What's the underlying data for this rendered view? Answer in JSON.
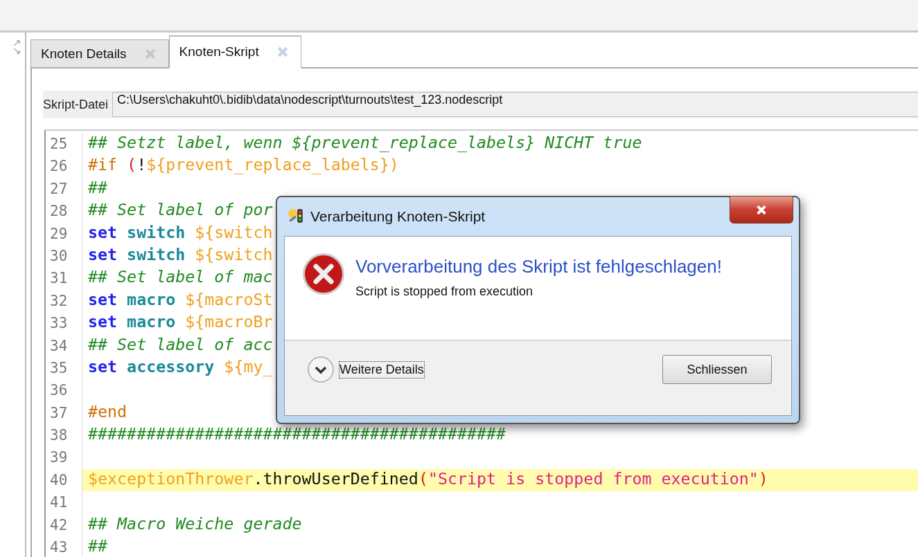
{
  "tabs": [
    {
      "label": "Knoten Details",
      "selected": false
    },
    {
      "label": "Knoten-Skript",
      "selected": true
    }
  ],
  "script_file": {
    "label": "Skript-Datei",
    "value": "C:\\Users\\chakuht0\\.bidib\\data\\nodescript\\turnouts\\test_123.nodescript"
  },
  "editor": {
    "lines": [
      {
        "number": "25",
        "highlighted": false,
        "tokens": [
          {
            "text": "## Setzt label, wenn ${prevent_replace_labels} NICHT true",
            "kind": "comment"
          }
        ]
      },
      {
        "number": "26",
        "highlighted": false,
        "tokens": [
          {
            "text": "#if ",
            "kind": "directive"
          },
          {
            "text": "(",
            "kind": "paren"
          },
          {
            "text": "!",
            "kind": "plain"
          },
          {
            "text": "${prevent_replace_labels})",
            "kind": "variable"
          }
        ]
      },
      {
        "number": "27",
        "highlighted": false,
        "tokens": [
          {
            "text": "##",
            "kind": "comment"
          }
        ]
      },
      {
        "number": "28",
        "highlighted": false,
        "tokens": [
          {
            "text": "## Set label of por",
            "kind": "comment"
          }
        ]
      },
      {
        "number": "29",
        "highlighted": false,
        "tokens": [
          {
            "text": "set",
            "kind": "keyword"
          },
          {
            "text": " switch",
            "kind": "command"
          },
          {
            "text": " ${switch",
            "kind": "variable"
          }
        ]
      },
      {
        "number": "30",
        "highlighted": false,
        "tokens": [
          {
            "text": "set",
            "kind": "keyword"
          },
          {
            "text": " switch",
            "kind": "command"
          },
          {
            "text": " ${switch",
            "kind": "variable"
          }
        ]
      },
      {
        "number": "31",
        "highlighted": false,
        "tokens": [
          {
            "text": "## Set label of mac",
            "kind": "comment"
          }
        ]
      },
      {
        "number": "32",
        "highlighted": false,
        "tokens": [
          {
            "text": "set",
            "kind": "keyword"
          },
          {
            "text": " macro",
            "kind": "command"
          },
          {
            "text": " ${macroSt",
            "kind": "variable"
          }
        ]
      },
      {
        "number": "33",
        "highlighted": false,
        "tokens": [
          {
            "text": "set",
            "kind": "keyword"
          },
          {
            "text": " macro",
            "kind": "command"
          },
          {
            "text": " ${macroBr",
            "kind": "variable"
          }
        ]
      },
      {
        "number": "34",
        "highlighted": false,
        "tokens": [
          {
            "text": "## Set label of acc",
            "kind": "comment"
          }
        ]
      },
      {
        "number": "35",
        "highlighted": false,
        "tokens": [
          {
            "text": "set",
            "kind": "keyword"
          },
          {
            "text": " accessory",
            "kind": "command"
          },
          {
            "text": " ${my_",
            "kind": "variable"
          }
        ]
      },
      {
        "number": "36",
        "highlighted": false
      },
      {
        "number": "37",
        "highlighted": false,
        "tokens": [
          {
            "text": "#end",
            "kind": "directive"
          }
        ]
      },
      {
        "number": "38",
        "highlighted": false,
        "tokens": [
          {
            "text": "###########################################",
            "kind": "comment"
          }
        ]
      },
      {
        "number": "39",
        "highlighted": false
      },
      {
        "number": "40",
        "highlighted": true,
        "tokens": [
          {
            "text": "$exceptionThrower",
            "kind": "variable"
          },
          {
            "text": ".throwUserDefined",
            "kind": "plain"
          },
          {
            "text": "(",
            "kind": "paren"
          },
          {
            "text": "\"Script is stopped from execution\"",
            "kind": "string"
          },
          {
            "text": ")",
            "kind": "paren"
          }
        ]
      },
      {
        "number": "41",
        "highlighted": false
      },
      {
        "number": "42",
        "highlighted": false,
        "tokens": [
          {
            "text": "## Macro Weiche gerade",
            "kind": "comment"
          }
        ]
      },
      {
        "number": "43",
        "highlighted": false,
        "tokens": [
          {
            "text": "##",
            "kind": "comment"
          }
        ]
      }
    ]
  },
  "dialog": {
    "title": "Verarbeitung Knoten-Skript",
    "heading": "Vorverarbeitung des Skript ist fehlgeschlagen!",
    "message": "Script is stopped from execution",
    "details_toggle": "Weitere Details",
    "close_button": "Schliessen"
  }
}
